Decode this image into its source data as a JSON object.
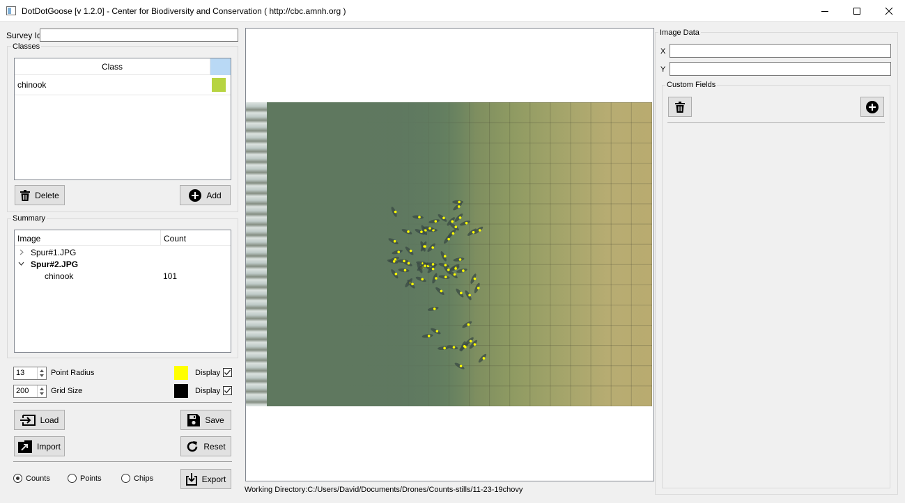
{
  "window": {
    "title": "DotDotGoose [v 1.2.0] - Center for Biodiversity and Conservation ( http://cbc.amnh.org )"
  },
  "survey": {
    "label": "Survey Id",
    "value": ""
  },
  "classes": {
    "legend": "Classes",
    "column_header": "Class",
    "items": [
      {
        "name": "chinook",
        "color": "#b7d441"
      }
    ],
    "delete_label": "Delete",
    "add_label": "Add"
  },
  "summary": {
    "legend": "Summary",
    "headers": {
      "image": "Image",
      "count": "Count"
    },
    "rows": [
      {
        "image": "Spur#1.JPG",
        "expanded": false
      },
      {
        "image": "Spur#2.JPG",
        "expanded": true,
        "children": [
          {
            "class": "chinook",
            "count": "101"
          }
        ]
      }
    ]
  },
  "settings": {
    "point_radius": {
      "value": "13",
      "label": "Point Radius",
      "color": "#ffff00",
      "display_label": "Display",
      "display": true
    },
    "grid_size": {
      "value": "200",
      "label": "Grid Size",
      "color": "#000000",
      "display_label": "Display",
      "display": true
    }
  },
  "actions": {
    "load": "Load",
    "save": "Save",
    "import": "Import",
    "reset": "Reset",
    "export": "Export"
  },
  "modes": {
    "options": [
      "Counts",
      "Points",
      "Chips"
    ],
    "selected": "Counts"
  },
  "status": {
    "working_directory": "Working Directory:C:/Users/David/Documents/Drones/Counts-stills/11-23-19chovy"
  },
  "image_data": {
    "legend": "Image Data",
    "x_label": "X",
    "x_value": "",
    "y_label": "Y",
    "y_value": "",
    "custom_fields_legend": "Custom Fields"
  },
  "icons": {
    "delete": "trash-icon",
    "add": "plus-circle-icon",
    "load": "load-icon",
    "save": "floppy-icon",
    "import": "import-icon",
    "reset": "refresh-icon",
    "export": "export-icon"
  },
  "colors": {
    "point": "#ffff00",
    "grid": "#000000",
    "class_header_swatch": "#b9d9f5"
  }
}
